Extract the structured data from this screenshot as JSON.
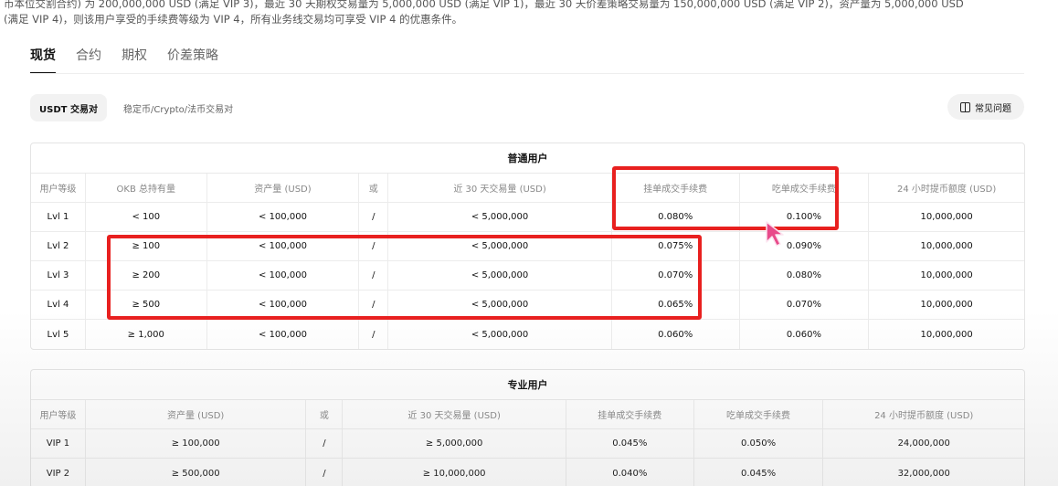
{
  "intro": {
    "line1": "币本位交割合约) 为 200,000,000 USD (满足 VIP 3)，最近 30 天期权交易量为 5,000,000 USD (满足 VIP 1)，最近 30 天价差策略交易量为 150,000,000 USD (满足 VIP 2)，资产量为 5,000,000 USD",
    "line2": "(满足 VIP 4)，则该用户享受的手续费等级为 VIP 4，所有业务线交易均可享受 VIP 4 的优惠条件。"
  },
  "tabs": [
    {
      "label": "现货",
      "active": true
    },
    {
      "label": "合约",
      "active": false
    },
    {
      "label": "期权",
      "active": false
    },
    {
      "label": "价差策略",
      "active": false
    }
  ],
  "filters": {
    "usdt_pairs": "USDT 交易对",
    "other_pairs": "稳定币/Crypto/法币交易对",
    "faq": "常见问题"
  },
  "regular": {
    "title": "普通用户",
    "headers": [
      "用户等级",
      "OKB 总持有量",
      "资产量 (USD)",
      "或",
      "近 30 天交易量 (USD)",
      "挂单成交手续费",
      "吃单成交手续费",
      "24 小时提币额度 (USD)"
    ],
    "rows": [
      [
        "Lvl 1",
        "< 100",
        "< 100,000",
        "/",
        "< 5,000,000",
        "0.080%",
        "0.100%",
        "10,000,000"
      ],
      [
        "Lvl 2",
        "≥ 100",
        "< 100,000",
        "/",
        "< 5,000,000",
        "0.075%",
        "0.090%",
        "10,000,000"
      ],
      [
        "Lvl 3",
        "≥ 200",
        "< 100,000",
        "/",
        "< 5,000,000",
        "0.070%",
        "0.080%",
        "10,000,000"
      ],
      [
        "Lvl 4",
        "≥ 500",
        "< 100,000",
        "/",
        "< 5,000,000",
        "0.065%",
        "0.070%",
        "10,000,000"
      ],
      [
        "Lvl 5",
        "≥ 1,000",
        "< 100,000",
        "/",
        "< 5,000,000",
        "0.060%",
        "0.060%",
        "10,000,000"
      ]
    ]
  },
  "pro": {
    "title": "专业用户",
    "headers": [
      "用户等级",
      "资产量 (USD)",
      "或",
      "近 30 天交易量 (USD)",
      "挂单成交手续费",
      "吃单成交手续费",
      "24 小时提币额度 (USD)"
    ],
    "rows": [
      [
        "VIP 1",
        "≥ 100,000",
        "/",
        "≥ 5,000,000",
        "0.045%",
        "0.050%",
        "24,000,000"
      ],
      [
        "VIP 2",
        "≥ 500,000",
        "/",
        "≥ 10,000,000",
        "0.040%",
        "0.045%",
        "32,000,000"
      ]
    ]
  },
  "colors": {
    "highlight": "#e8201f",
    "cursor": "#e84a8a"
  },
  "icons": [
    "faq-book-icon",
    "mouse-pointer-icon"
  ]
}
